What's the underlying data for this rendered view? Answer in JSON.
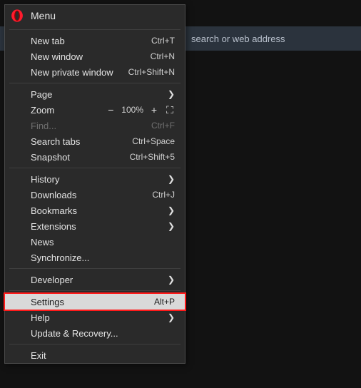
{
  "background": {
    "search_placeholder_fragment": "search or web address"
  },
  "header": {
    "title": "Menu"
  },
  "items": {
    "new_tab": {
      "label": "New tab",
      "shortcut": "Ctrl+T"
    },
    "new_window": {
      "label": "New window",
      "shortcut": "Ctrl+N"
    },
    "new_private": {
      "label": "New private window",
      "shortcut": "Ctrl+Shift+N"
    },
    "page": {
      "label": "Page"
    },
    "zoom": {
      "label": "Zoom",
      "value": "100%"
    },
    "find": {
      "label": "Find...",
      "shortcut": "Ctrl+F"
    },
    "search_tabs": {
      "label": "Search tabs",
      "shortcut": "Ctrl+Space"
    },
    "snapshot": {
      "label": "Snapshot",
      "shortcut": "Ctrl+Shift+5"
    },
    "history": {
      "label": "History"
    },
    "downloads": {
      "label": "Downloads",
      "shortcut": "Ctrl+J"
    },
    "bookmarks": {
      "label": "Bookmarks"
    },
    "extensions": {
      "label": "Extensions"
    },
    "news": {
      "label": "News"
    },
    "synchronize": {
      "label": "Synchronize..."
    },
    "developer": {
      "label": "Developer"
    },
    "settings": {
      "label": "Settings",
      "shortcut": "Alt+P"
    },
    "help": {
      "label": "Help"
    },
    "update": {
      "label": "Update & Recovery..."
    },
    "exit": {
      "label": "Exit"
    }
  }
}
